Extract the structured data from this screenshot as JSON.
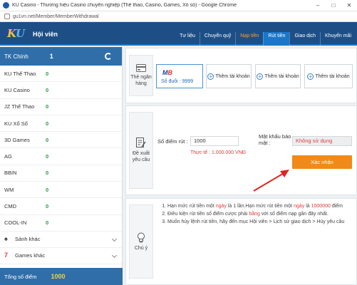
{
  "browser": {
    "title": "KU Casino - Thương hiệu Casino chuyên nghiệp (Thể thao, Casino, Games, Xổ số) - Google Chrome",
    "url": "gu1vn.net/Member/MemberWithdrawal",
    "min": "–",
    "max": "□",
    "close": "✕"
  },
  "header": {
    "logo_k": "K",
    "logo_u": "U",
    "title": "Hội viên",
    "nav": [
      "Tư liệu",
      "Chuyển quỹ",
      "Nạp tiền",
      "Rút tiền",
      "Giao dịch",
      "Khuyến mãi"
    ]
  },
  "sidebar": {
    "main": {
      "label": "TK Chính",
      "value": "1"
    },
    "rows": [
      {
        "label": "KU Thể Thao",
        "value": "0"
      },
      {
        "label": "KU Casino",
        "value": "0"
      },
      {
        "label": "JZ Thể Thao",
        "value": "0"
      },
      {
        "label": "KU Xổ Số",
        "value": "0"
      },
      {
        "label": "3D Games",
        "value": "0"
      },
      {
        "label": "AG",
        "value": "0"
      },
      {
        "label": "BBIN",
        "value": "0"
      },
      {
        "label": "WM",
        "value": "0"
      },
      {
        "label": "CMD",
        "value": "0"
      },
      {
        "label": "COOL-IN",
        "value": "0"
      }
    ],
    "expanders": [
      {
        "label": "Sảnh khác",
        "icon": "♠"
      },
      {
        "label": "Games khác",
        "icon": "7"
      }
    ],
    "total": {
      "label": "Tổng số điểm",
      "value": "1000"
    }
  },
  "bank": {
    "label_line1": "Thẻ ngân",
    "label_line2": "hàng",
    "card_logo_a": "M",
    "card_logo_b": "B",
    "card_acct": "Số đuôi : 9999",
    "add_label": "Thêm tài khoản"
  },
  "withdraw": {
    "label_line1": "Đề xuất",
    "label_line2": "yêu cầu",
    "points_label": "Số điểm rút :",
    "points_value": "1000",
    "actual": "Thực tế : 1.000.000 VNĐ",
    "pwd_label_line1": "Mật khẩu bảo",
    "pwd_label_line2": "mật :",
    "pwd_value": "Không sử dụng",
    "confirm": "Xác nhận"
  },
  "notes": {
    "label": "Chú ý",
    "n1a": "Hạn mức rút tiền một ",
    "n1b": "ngày",
    "n1c": " là 1 lần.Hạn mức rút tiền một ",
    "n1d": "ngày",
    "n1e": " là ",
    "n1f": "1000000",
    "n1g": " điểm",
    "n2a": "Điều kiện rút tiền số điểm cược phải ",
    "n2b": "bằng",
    "n2c": " với số điểm nạp gần đây nhất.",
    "n3": "Muốn hủy lệnh rút tiền, hãy đến mục Hội viên > Lịch sử giao dịch > Hủy yêu cầu"
  }
}
